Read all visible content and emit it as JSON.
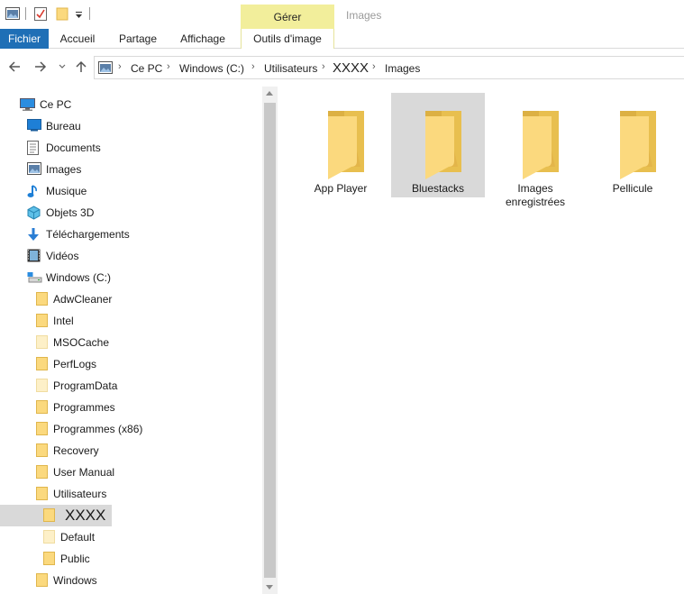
{
  "ribbon": {
    "contextual_group": "Gérer",
    "contextual_title": "Images",
    "tabs": {
      "file": "Fichier",
      "home": "Accueil",
      "share": "Partage",
      "view": "Affichage",
      "image_tools": "Outils d'image"
    }
  },
  "address": {
    "crumbs": [
      "Ce PC",
      "Windows (C:)",
      "Utilisateurs",
      "XXXX",
      "Images"
    ]
  },
  "sidebar": {
    "root": "Ce PC",
    "items": [
      {
        "label": "Bureau",
        "icon": "desktop-icon"
      },
      {
        "label": "Documents",
        "icon": "documents-icon"
      },
      {
        "label": "Images",
        "icon": "pictures-icon"
      },
      {
        "label": "Musique",
        "icon": "music-icon"
      },
      {
        "label": "Objets 3D",
        "icon": "3d-objects-icon"
      },
      {
        "label": "Téléchargements",
        "icon": "downloads-icon"
      },
      {
        "label": "Vidéos",
        "icon": "videos-icon"
      },
      {
        "label": "Windows (C:)",
        "icon": "drive-icon"
      }
    ],
    "drive_folders": [
      {
        "label": "AdwCleaner",
        "faded": false
      },
      {
        "label": "Intel",
        "faded": false
      },
      {
        "label": "MSOCache",
        "faded": true
      },
      {
        "label": "PerfLogs",
        "faded": false
      },
      {
        "label": "ProgramData",
        "faded": true
      },
      {
        "label": "Programmes",
        "faded": false
      },
      {
        "label": "Programmes (x86)",
        "faded": false
      },
      {
        "label": "Recovery",
        "faded": false
      },
      {
        "label": "User Manual",
        "faded": false
      },
      {
        "label": "Utilisateurs",
        "faded": false
      }
    ],
    "user_folders": [
      {
        "label": "XXXX",
        "selected": true,
        "faded": false
      },
      {
        "label": "Default",
        "selected": false,
        "faded": true
      },
      {
        "label": "Public",
        "selected": false,
        "faded": false
      }
    ],
    "last_folder": "Windows"
  },
  "content": {
    "folders": [
      {
        "label": "App Player",
        "selected": false
      },
      {
        "label": "Bluestacks",
        "selected": true
      },
      {
        "label": "Images enregistrées",
        "selected": false
      },
      {
        "label": "Pellicule",
        "selected": false
      }
    ]
  },
  "colors": {
    "file_tab": "#1f6fb6",
    "contextual": "#f2ee9b",
    "selection": "#d9d9d9",
    "folder_back": "#e8bf4f",
    "folder_front": "#fbd97e"
  }
}
